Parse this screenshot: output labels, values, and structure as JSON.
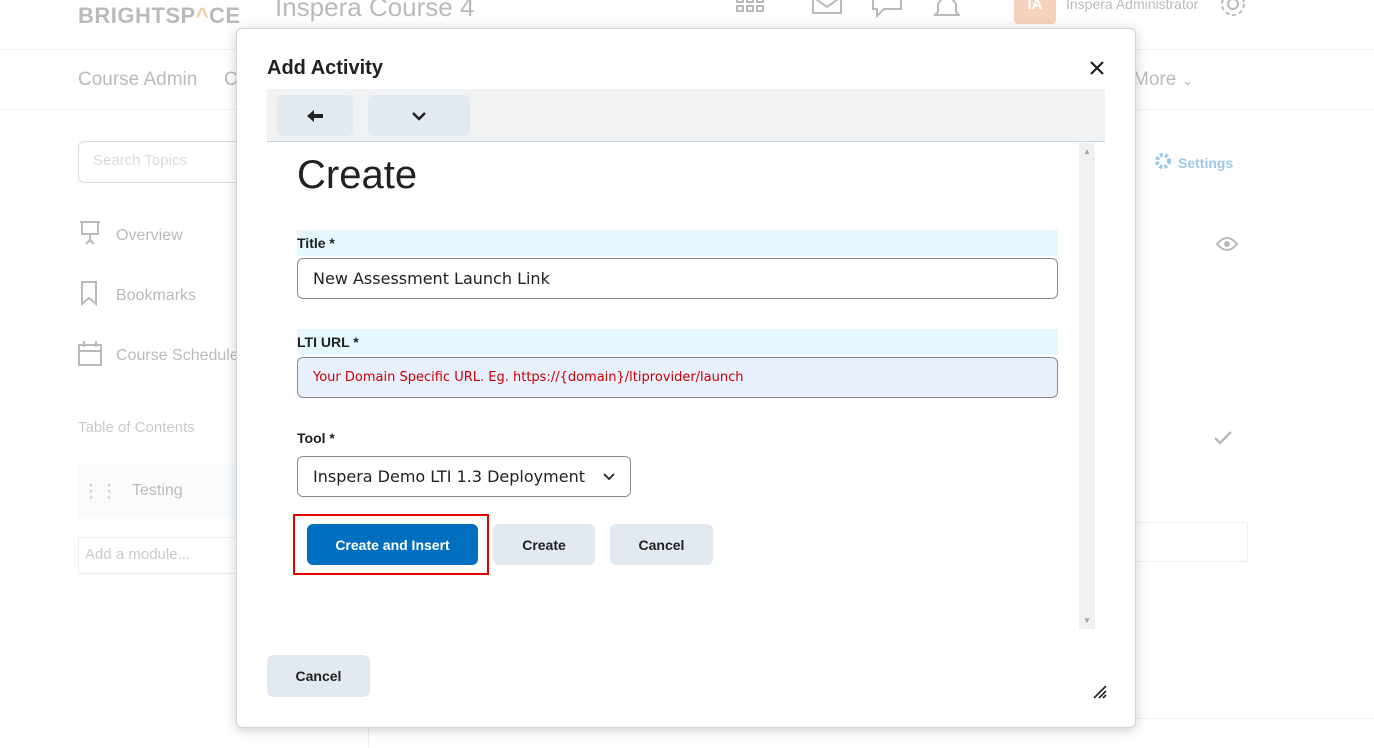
{
  "background": {
    "logo": {
      "text_left": "BRIGHTSP",
      "text_accent": "^",
      "text_right": "CE"
    },
    "course_title": "Inspera Course 4",
    "user": {
      "initials": "IA",
      "name": "Inspera Administrator"
    },
    "nav": {
      "course_admin": "Course Admin",
      "partial_item": "C",
      "more": "More"
    },
    "search": {
      "placeholder": "Search Topics"
    },
    "sidebar": {
      "items": [
        {
          "label": "Overview",
          "icon": "presentation-icon"
        },
        {
          "label": "Bookmarks",
          "icon": "bookmark-icon"
        },
        {
          "label": "Course Schedule",
          "icon": "calendar-icon"
        }
      ],
      "toc_label": "Table of Contents",
      "module": "Testing",
      "add_module_placeholder": "Add a module..."
    },
    "settings_label": "Settings"
  },
  "dialog": {
    "title": "Add Activity",
    "heading": "Create",
    "title_field": {
      "label": "Title *",
      "value": "New Assessment Launch Link"
    },
    "url_field": {
      "label": "LTI URL *",
      "placeholder": "Your Domain Specific URL. Eg. https://{domain}/ltiprovider/launch"
    },
    "tool_field": {
      "label": "Tool *",
      "selected": "Inspera Demo LTI 1.3 Deployment"
    },
    "buttons": {
      "create_insert": "Create and Insert",
      "create": "Create",
      "cancel": "Cancel"
    },
    "footer_cancel": "Cancel"
  },
  "colors": {
    "primary": "#006fbf",
    "secondary_button": "#e3e9f1",
    "highlight": "#e00000",
    "placeholder_text": "#cc0000",
    "label_bg": "#e6f8ff"
  }
}
